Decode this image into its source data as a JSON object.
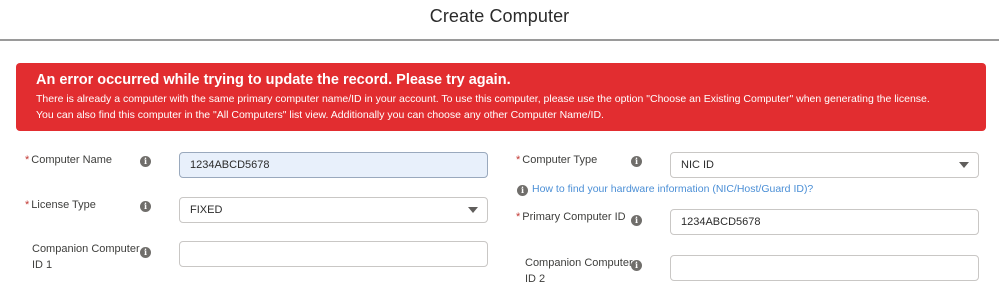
{
  "page": {
    "title": "Create Computer"
  },
  "error": {
    "title": "An error occurred while trying to update the record. Please try again.",
    "line1": "There is already a computer with the same primary computer name/ID in your account. To use this computer, please use the option \"Choose an Existing Computer\" when generating the license.",
    "line2": "You can also find this computer in the \"All Computers\" list view. Additionally you can choose any other Computer Name/ID."
  },
  "form": {
    "required_mark": "*",
    "info_glyph": "i",
    "computer_name": {
      "label": "Computer Name",
      "value": "1234ABCD5678"
    },
    "license_type": {
      "label": "License Type",
      "value": "FIXED"
    },
    "companion_id_1": {
      "label_line1": "Companion Computer",
      "label_line2": "ID 1",
      "value": ""
    },
    "computer_type": {
      "label": "Computer Type",
      "value": "NIC ID"
    },
    "help_link": "How to find your hardware information (NIC/Host/Guard ID)?",
    "primary_computer_id": {
      "label": "Primary Computer ID",
      "value": "1234ABCD5678"
    },
    "companion_id_2": {
      "label_line1": "Companion Computer",
      "label_line2": "ID 2",
      "value": ""
    }
  },
  "colors": {
    "error_bg": "#e22d30",
    "link": "#4b8fd6",
    "required": "#c23934"
  },
  "icons": {
    "info": "info-icon",
    "dropdown": "chevron-down-icon"
  }
}
